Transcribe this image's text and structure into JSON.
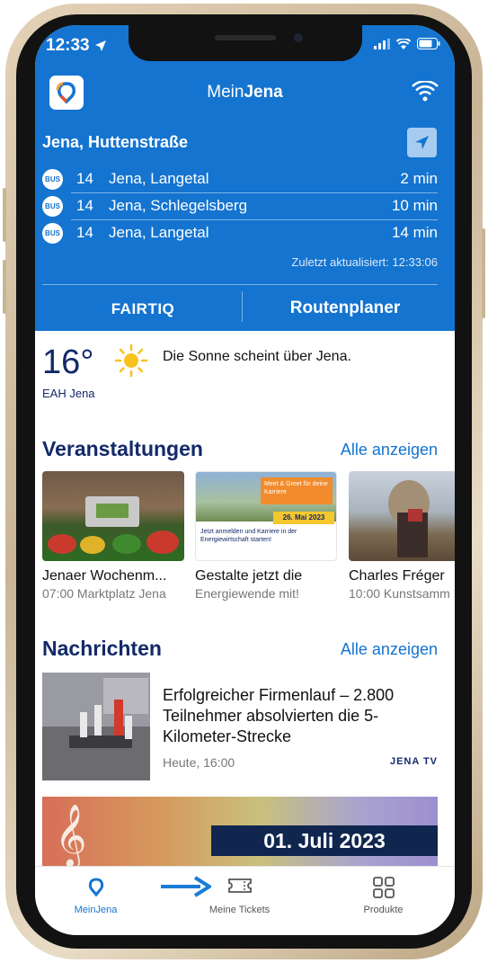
{
  "status": {
    "time": "12:33"
  },
  "header": {
    "title_prefix": "Mein",
    "title_bold": "Jena"
  },
  "location": {
    "title": "Jena, Huttenstraße"
  },
  "departures": [
    {
      "badge": "BUS",
      "line": "14",
      "destination": "Jena, Langetal",
      "time": "2 min"
    },
    {
      "badge": "BUS",
      "line": "14",
      "destination": "Jena, Schlegelsberg",
      "time": "10 min"
    },
    {
      "badge": "BUS",
      "line": "14",
      "destination": "Jena, Langetal",
      "time": "14 min"
    }
  ],
  "last_updated": "Zuletzt aktualisiert: 12:33:06",
  "actions": {
    "fairtiq": "FAIRTIQ",
    "routenplaner": "Routenplaner"
  },
  "weather": {
    "temperature": "16°",
    "station": "EAH Jena",
    "text": "Die Sonne scheint über Jena."
  },
  "events": {
    "title": "Veranstaltungen",
    "link": "Alle anzeigen",
    "items": [
      {
        "title": "Jenaer Wochenm...",
        "subtitle": "07:00 Marktplatz Jena"
      },
      {
        "title": "Gestalte jetzt die",
        "subtitle": "Energiewende mit!",
        "img_badge": "Meet & Greet für deine Karriere",
        "img_date": "26. Mai 2023",
        "img_text": "Jetzt anmelden und Karriere in der Energiewirtschaft starten!"
      },
      {
        "title": "Charles Fréger",
        "subtitle": "10:00 Kunstsamm"
      }
    ]
  },
  "news": {
    "title": "Nachrichten",
    "link": "Alle anzeigen",
    "item": {
      "title": "Erfolgreicher Firmenlauf – 2.800 Teilnehmer absolvierten die 5-Kilometer-Strecke",
      "time": "Heute, 16:00",
      "source": "JENA TV"
    }
  },
  "banner": {
    "date": "01. Juli 2023"
  },
  "tabs": [
    {
      "label": "MeinJena",
      "icon": "meinjena-icon",
      "active": true
    },
    {
      "label": "Meine Tickets",
      "icon": "ticket-icon",
      "active": false
    },
    {
      "label": "Produkte",
      "icon": "grid-icon",
      "active": false
    }
  ],
  "colors": {
    "brand_blue": "#1474d0",
    "navy": "#13296a",
    "tab_active": "#1474d0"
  }
}
